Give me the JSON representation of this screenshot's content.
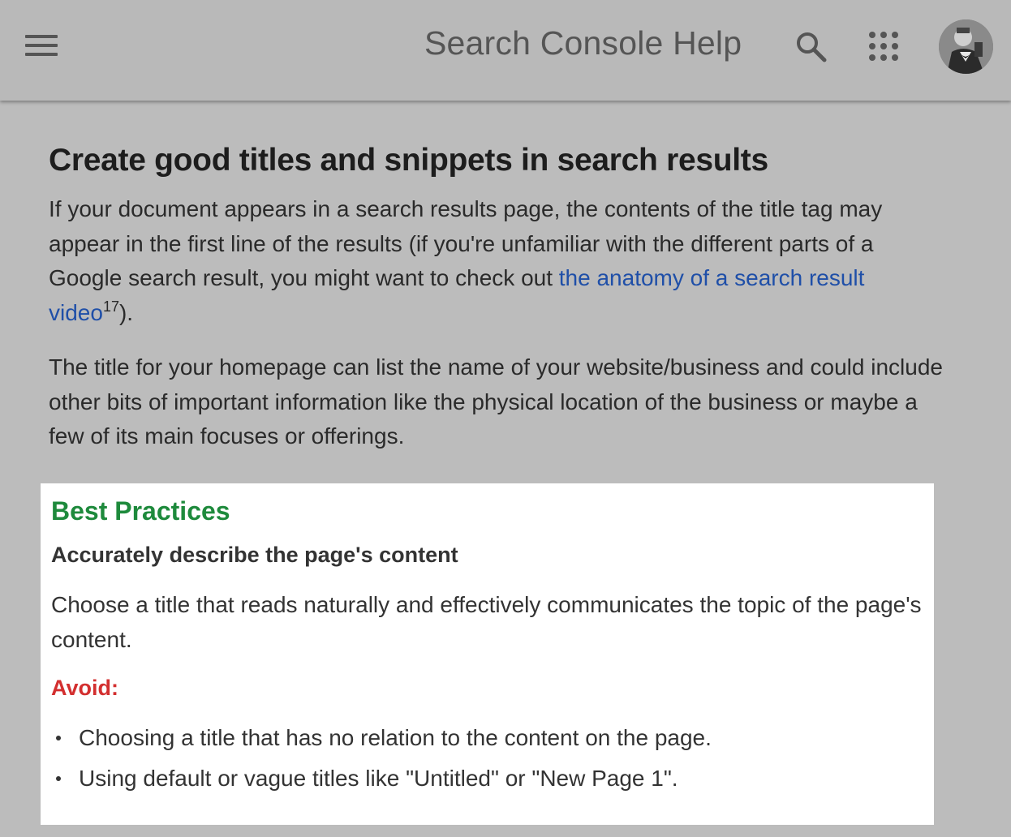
{
  "header": {
    "title": "Search Console Help",
    "menu_icon": "menu-icon",
    "search_icon": "search-icon",
    "apps_icon": "apps-grid-icon",
    "avatar": "user-avatar",
    "background_color": "#b9b9b9"
  },
  "article": {
    "title": "Create good titles and snippets in search results",
    "paragraph1": {
      "text_before_link": "If your document appears in a search results page, the contents of the title tag may appear in the first line of the results (if you're unfamiliar with the different parts of a Google search result, you might want to check out ",
      "link_text": "the anatomy of a search result video",
      "footnote": "17",
      "text_after_link": ")."
    },
    "paragraph2": "The title for your homepage can list the name of your website/business and could include other bits of important information like the physical location of the business or maybe a few of its main focuses or offerings."
  },
  "best_practices": {
    "heading": "Best Practices",
    "heading_color": "#1e8a3c",
    "subheading": "Accurately describe the page's content",
    "text": "Choose a title that reads naturally and effectively communicates the topic of the page's content.",
    "avoid_label": "Avoid:",
    "avoid_color": "#d32f2f",
    "avoid_items": [
      "Choosing a title that has no relation to the content on the page.",
      "Using default or vague titles like \"Untitled\" or \"New Page 1\"."
    ]
  },
  "colors": {
    "page_background": "#bcbcbc",
    "link": "#1f4fa8",
    "card_background": "#ffffff"
  }
}
